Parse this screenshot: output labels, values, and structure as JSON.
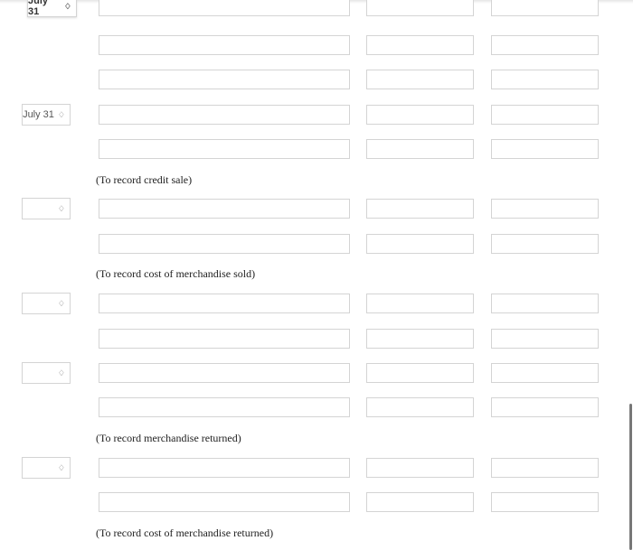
{
  "entries": [
    {
      "date": "July 31",
      "lines": 3,
      "note": ""
    },
    {
      "date": "July 31",
      "lines": 2,
      "note": "(To record credit sale)"
    },
    {
      "date": "",
      "lines": 2,
      "note": "(To record cost of merchandise sold)"
    },
    {
      "date": "",
      "lines": 2,
      "note": ""
    },
    {
      "date": "",
      "lines": 2,
      "note": "(To record merchandise returned)"
    },
    {
      "date": "",
      "lines": 2,
      "note": "(To record cost of merchandise returned)"
    }
  ],
  "icons": {
    "date_select": "up-down-chevron-icon"
  }
}
